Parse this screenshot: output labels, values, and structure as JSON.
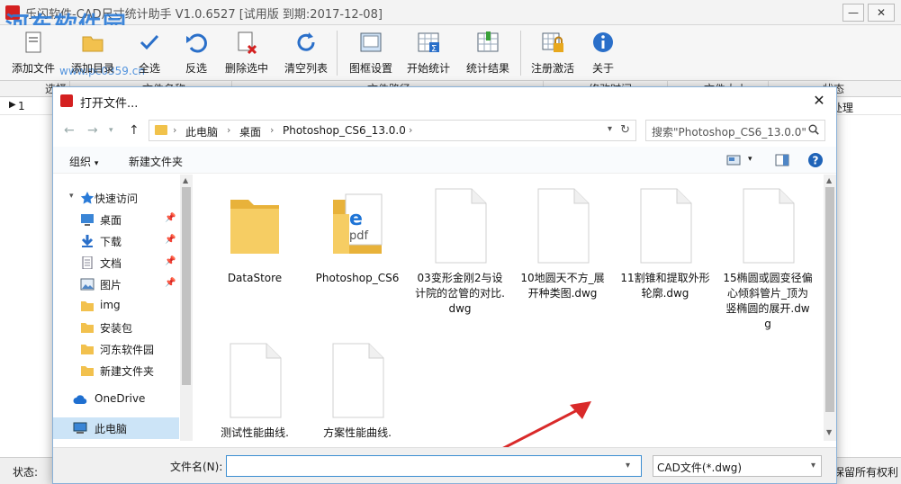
{
  "window": {
    "title": "乐闪软件-CAD尺寸统计助手 V1.0.6527 [试用版 到期:2017-12-08]",
    "watermark": "河东软件园",
    "watermark_url": "www.pc0359.cn",
    "min": "—",
    "max": "☐",
    "close": "✕"
  },
  "toolbar": {
    "add_file": "添加文件",
    "add_dir": "添加目录",
    "select_all": "全选",
    "invert": "反选",
    "delete_sel": "删除选中",
    "clear_list": "清空列表",
    "frame_settings": "图框设置",
    "start_stats": "开始统计",
    "stats_result": "统计结果",
    "register": "注册激活",
    "about": "关于"
  },
  "grid": {
    "headers": [
      "选择",
      "文件名称",
      "文件路径",
      "修改时间",
      "文件大小",
      "状态"
    ],
    "row1_index": "1",
    "row1_status": "待处理"
  },
  "statusbar": {
    "label": "状态:",
    "copyright": "版权所有 © 乐闪软件 保留所有权利"
  },
  "dialog": {
    "title": "打开文件...",
    "close": "✕",
    "breadcrumbs": [
      "此电脑",
      "桌面",
      "Photoshop_CS6_13.0.0"
    ],
    "search_placeholder": "搜索\"Photoshop_CS6_13.0.0\"",
    "organize": "组织",
    "new_folder": "新建文件夹",
    "nav": [
      {
        "label": "快速访问",
        "icon": "star-icon"
      },
      {
        "label": "桌面",
        "icon": "desktop-icon",
        "pinned": true
      },
      {
        "label": "下载",
        "icon": "download-icon",
        "pinned": true
      },
      {
        "label": "文档",
        "icon": "document-icon",
        "pinned": true
      },
      {
        "label": "图片",
        "icon": "picture-icon",
        "pinned": true
      },
      {
        "label": "img",
        "icon": "folder-icon"
      },
      {
        "label": "安装包",
        "icon": "folder-icon"
      },
      {
        "label": "河东软件园",
        "icon": "folder-icon"
      },
      {
        "label": "新建文件夹",
        "icon": "folder-icon"
      },
      {
        "label": "OneDrive",
        "icon": "cloud-icon"
      },
      {
        "label": "此电脑",
        "icon": "computer-icon"
      }
    ],
    "files": [
      {
        "name": "DataStore",
        "kind": "folder"
      },
      {
        "name": "Photoshop_CS6",
        "kind": "pdf-folder"
      },
      {
        "name": "03变形金刚2与设计院的岔管的对比.dwg",
        "kind": "file"
      },
      {
        "name": "10地圆天不方_展开种类图.dwg",
        "kind": "file"
      },
      {
        "name": "11割锥和提取外形轮廓.dwg",
        "kind": "file"
      },
      {
        "name": "15椭圆或圆变径偏心倾斜管片_顶为竖椭圆的展开.dwg",
        "kind": "file"
      },
      {
        "name": "测试性能曲线.",
        "kind": "file"
      },
      {
        "name": "方案性能曲线.",
        "kind": "file"
      }
    ],
    "filename_label": "文件名(N):",
    "filename_value": "",
    "file_type": "CAD文件(*.dwg)"
  },
  "colors": {
    "folder": "#f2c14e",
    "accent": "#2a7bd8",
    "arrow": "#d92a2a"
  }
}
